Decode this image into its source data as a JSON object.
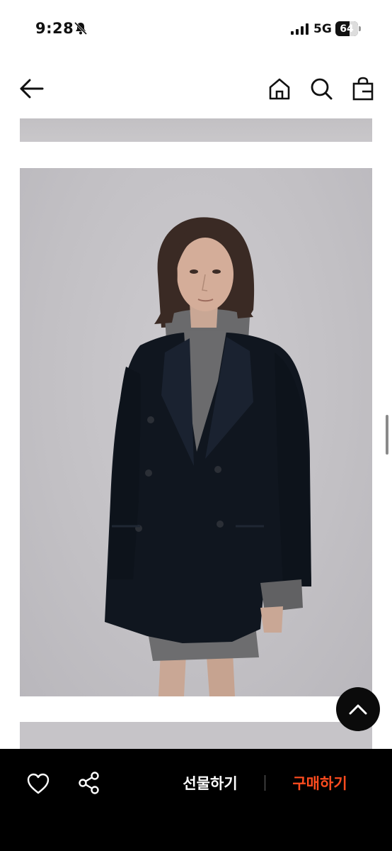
{
  "status_bar": {
    "time": "9:28",
    "network": "5G",
    "battery": "64",
    "battery_level": 0.64
  },
  "header": {
    "icons": [
      "arrow-left-icon",
      "home-icon",
      "search-icon",
      "shopping-bag-icon"
    ]
  },
  "bottom_bar": {
    "gift_label": "선물하기",
    "buy_label": "구매하기",
    "icons": [
      "heart-icon",
      "share-icon"
    ],
    "buy_color": "#ff4c1f"
  },
  "colors": {
    "background": "#ffffff",
    "bottom_bar": "#000000",
    "accent": "#ff4c1f"
  }
}
